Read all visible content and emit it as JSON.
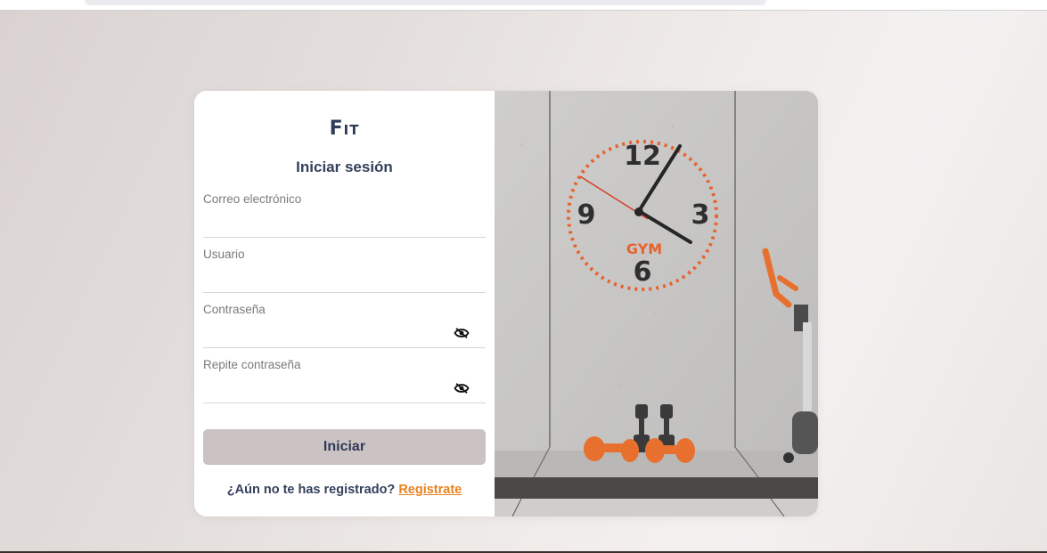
{
  "brand": {
    "logo_text": "Fit"
  },
  "form": {
    "title": "Iniciar sesión",
    "fields": [
      {
        "label": "Correo electrónico",
        "value": "",
        "has_eye": false
      },
      {
        "label": "Usuario",
        "value": "",
        "has_eye": false
      },
      {
        "label": "Contraseña",
        "value": "",
        "has_eye": true
      },
      {
        "label": "Repite contraseña",
        "value": "",
        "has_eye": true
      }
    ],
    "submit_label": "Iniciar",
    "register_prompt": "¿Aún no te has registrado?",
    "register_link": "Registrate"
  },
  "hero": {
    "clock_numbers": [
      "12",
      "3",
      "6",
      "9"
    ],
    "clock_brand": "GYM",
    "icon": "gym-wall-clock-illustration"
  },
  "colors": {
    "accent": "#e8821e",
    "text_dark": "#34405c",
    "button_bg": "#cbc3c3",
    "clock_orange": "#e8622e"
  }
}
